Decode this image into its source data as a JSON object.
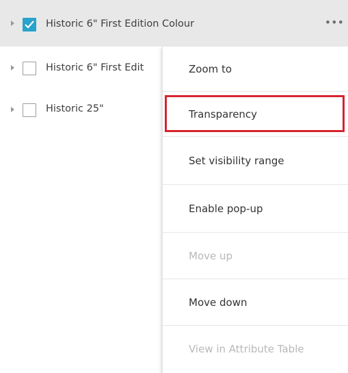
{
  "layers": [
    {
      "label": "Historic 6\" First Edition Colour",
      "checked": true,
      "selected": true
    },
    {
      "label": "Historic 6\" First Edit",
      "checked": false,
      "selected": false
    },
    {
      "label": "Historic 25\"",
      "checked": false,
      "selected": false
    }
  ],
  "more_icon": "more-horizontal-icon",
  "more_label": "•••",
  "menu": {
    "items": [
      {
        "label": "Zoom to",
        "enabled": true
      },
      {
        "label": "Transparency",
        "enabled": true,
        "highlighted": true
      },
      {
        "label": "Set visibility range",
        "enabled": true
      },
      {
        "label": "Enable pop-up",
        "enabled": true
      },
      {
        "label": "Move up",
        "enabled": false
      },
      {
        "label": "Move down",
        "enabled": true
      },
      {
        "label": "View in Attribute Table",
        "enabled": false
      }
    ]
  },
  "colors": {
    "checkbox_checked": "#27a3cc",
    "highlight_border": "#d6232f",
    "selected_row_bg": "#e8e8e8"
  }
}
